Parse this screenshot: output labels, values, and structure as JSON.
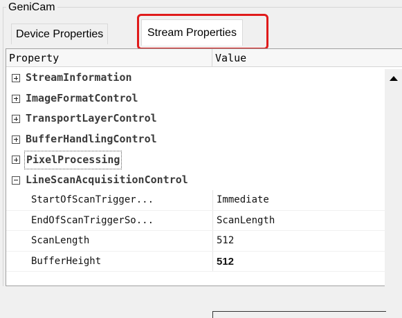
{
  "groupbox": {
    "title": "GeniCam"
  },
  "tabs": [
    {
      "label": "Device Properties",
      "active": false
    },
    {
      "label": "Stream Properties",
      "active": true
    }
  ],
  "grid": {
    "headers": {
      "property": "Property",
      "value": "Value"
    },
    "categories": [
      {
        "label": "StreamInformation",
        "expanded": false
      },
      {
        "label": "ImageFormatControl",
        "expanded": false
      },
      {
        "label": "TransportLayerControl",
        "expanded": false
      },
      {
        "label": "BufferHandlingControl",
        "expanded": false
      },
      {
        "label": "PixelProcessing",
        "expanded": false,
        "selected": true
      },
      {
        "label": "LineScanAcquisitionControl",
        "expanded": true
      }
    ],
    "properties": [
      {
        "name": "StartOfScanTrigger...",
        "value": "Immediate"
      },
      {
        "name": "EndOfScanTriggerSo...",
        "value": "ScanLength"
      },
      {
        "name": "ScanLength",
        "value": "512"
      },
      {
        "name": "BufferHeight",
        "value": "512",
        "modified": true
      }
    ]
  },
  "colors": {
    "highlight": "#e01a1a",
    "active_tab": "#ffffff"
  }
}
